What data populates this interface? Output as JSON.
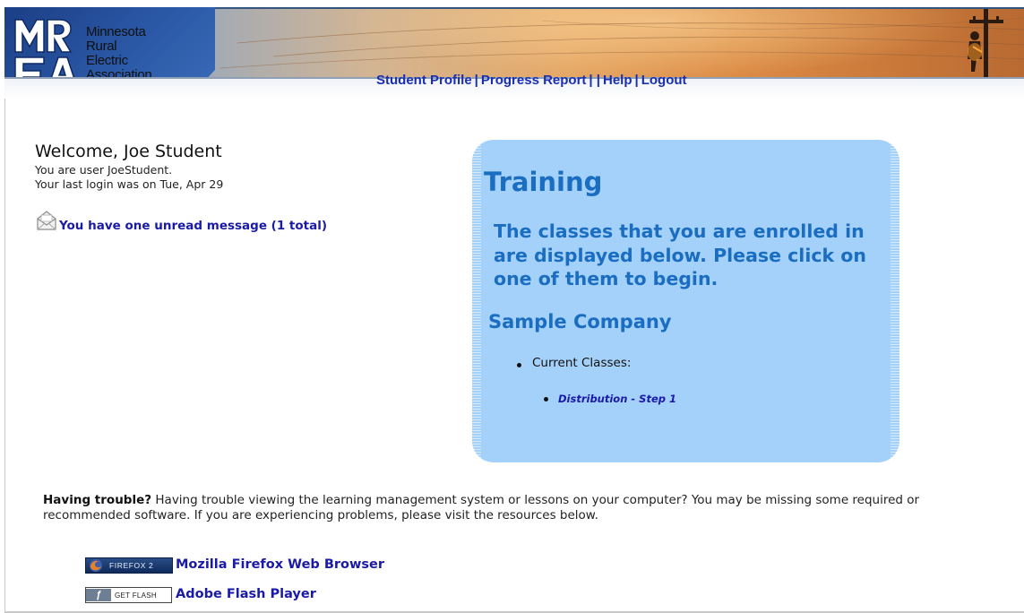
{
  "header": {
    "logo_lines": [
      "Minnesota",
      "Rural",
      "Electric",
      "Association"
    ],
    "logo_monogram": "MREA",
    "nav": [
      {
        "label": "Student Profile"
      },
      {
        "label": "Progress Report"
      },
      {
        "label": "Help"
      },
      {
        "label": "Logout"
      }
    ]
  },
  "welcome": {
    "title": "Welcome, Joe Student",
    "user_line": "You are user JoeStudent.",
    "login_line": "Your last login was on Tue, Apr 29",
    "message_link": "You have one unread message (1 total)",
    "message_icon": "envelope-icon"
  },
  "training": {
    "heading": "Training",
    "intro": "The classes that you are enrolled in are displayed below. Please click on one of them to begin.",
    "company": "Sample Company",
    "current_label": "Current Classes:",
    "classes": [
      {
        "label": "Distribution - Step 1"
      }
    ],
    "panel_color": "#a4d1f9",
    "text_color": "#1a6dc0"
  },
  "trouble": {
    "bold_lead": "Having trouble?",
    "text": "Having trouble viewing the learning management system or lessons on your computer? You may be missing some required or recommended software. If you are experiencing problems, please visit the resources below."
  },
  "resources": [
    {
      "badge_text": "FIREFOX 2",
      "label": "Mozilla Firefox Web Browser",
      "icon": "firefox-icon"
    },
    {
      "badge_text": "GET FLASH",
      "label": "Adobe Flash Player",
      "icon": "flash-icon"
    }
  ],
  "colors": {
    "link": "#1a1aa8",
    "nav_link": "#1a2fb0",
    "logo_blue": "#1c3f86"
  }
}
